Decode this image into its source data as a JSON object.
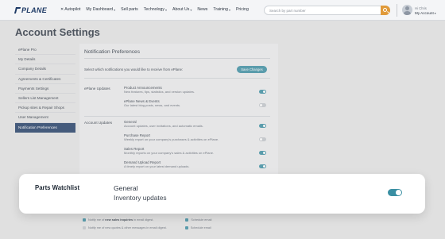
{
  "brand": {
    "logo_text": "PLANE",
    "accent": "#1f3b66",
    "teal": "#3a8fa3",
    "orange": "#e09a3a"
  },
  "nav": {
    "items": [
      {
        "label": "Autopilot",
        "icon": "x-icon",
        "caret": false
      },
      {
        "label": "My Dashboard",
        "caret": true
      },
      {
        "label": "Sell parts",
        "caret": false
      },
      {
        "label": "Technology",
        "caret": true
      },
      {
        "label": "About Us",
        "caret": true
      },
      {
        "label": "News",
        "caret": false
      },
      {
        "label": "Training",
        "caret": true
      },
      {
        "label": "Pricing",
        "caret": false
      }
    ],
    "search_placeholder": "Search by part number"
  },
  "user": {
    "greeting": "Hi Chris",
    "account_label": "My Account"
  },
  "page_title": "Account Settings",
  "sidebar": {
    "items": [
      {
        "label": "ePlane Pro",
        "active": false
      },
      {
        "label": "My Details",
        "active": false
      },
      {
        "label": "Company Details",
        "active": false
      },
      {
        "label": "Agreements & Certificates",
        "active": false
      },
      {
        "label": "Payments Settings",
        "active": false
      },
      {
        "label": "Sellers List Management",
        "active": false
      },
      {
        "label": "Pickup sites & Repair Shops",
        "active": false
      },
      {
        "label": "User Management",
        "active": false
      },
      {
        "label": "Notification Preferences",
        "active": true
      }
    ]
  },
  "notifications": {
    "section_title": "Notification Preferences",
    "intro": "Select which notifications you would like to receive from ePlane:",
    "save_label": "Save Changes",
    "groups": [
      {
        "label": "ePlane Updates",
        "options": [
          {
            "title": "Product Announcements",
            "desc": "New features, tips, statistics, and version updates.",
            "enabled": true
          },
          {
            "title": "ePlane News & Events",
            "desc": "Our latest blog posts, news, and events.",
            "enabled": false
          }
        ]
      },
      {
        "label": "Account Updates",
        "options": [
          {
            "title": "General",
            "desc": "Account updates, user invitations, and automatic emails.",
            "enabled": true
          },
          {
            "title": "Purchase Report",
            "desc": "Weekly report on your company's purchases & activities on ePlane.",
            "enabled": false
          },
          {
            "title": "Sales Report",
            "desc": "Monthly reports on your company's sales & activities on ePlane.",
            "enabled": true
          },
          {
            "title": "Demand Upload Report",
            "desc": "A timely report on your latest demand uploads.",
            "enabled": true
          }
        ]
      }
    ],
    "email_rows": [
      {
        "prefix": "Notify me of",
        "bold": "new sales inquiries",
        "suffix": "in email digest.",
        "checked": true,
        "schedule_label": "Schedule email",
        "schedule_checked": true
      },
      {
        "prefix": "Notify me of new quotes & other messages",
        "bold": "",
        "suffix": "in email digest.",
        "checked": false,
        "schedule_label": "Schedule email",
        "schedule_checked": true
      }
    ]
  },
  "highlight_card": {
    "group_title": "Parts Watchlist",
    "option_title": "General",
    "option_desc": "Inventory updates",
    "enabled": true
  }
}
